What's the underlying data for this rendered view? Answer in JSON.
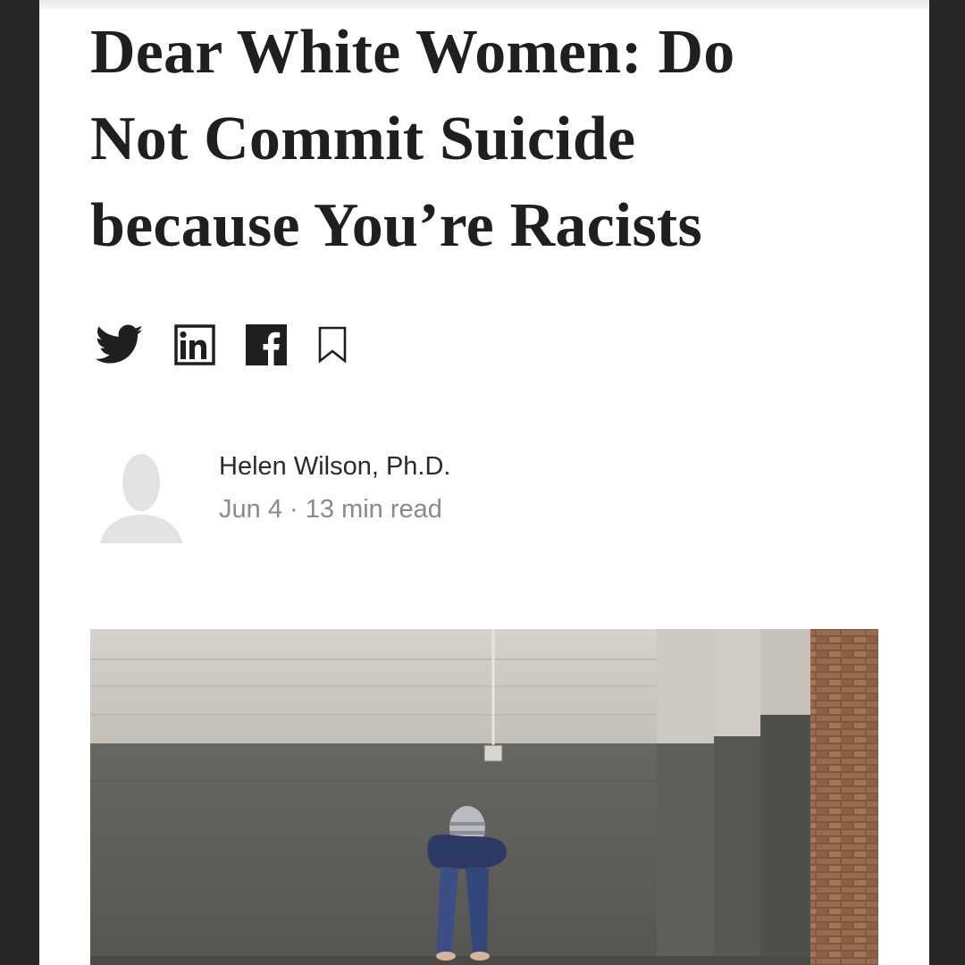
{
  "article": {
    "title": "Dear White Women: Do Not Commit Suicide because You’re Racists",
    "author_name": "Helen Wilson, Ph.D.",
    "date": "Jun 4",
    "separator": "·",
    "read_time": "13 min read"
  },
  "share": {
    "icons": [
      "twitter-icon",
      "linkedin-icon",
      "facebook-icon",
      "bookmark-icon"
    ]
  },
  "colors": {
    "text": "#1f1f1f",
    "meta": "#8a8a8a",
    "avatar": "#e3e3e3",
    "frame": "#262626"
  }
}
